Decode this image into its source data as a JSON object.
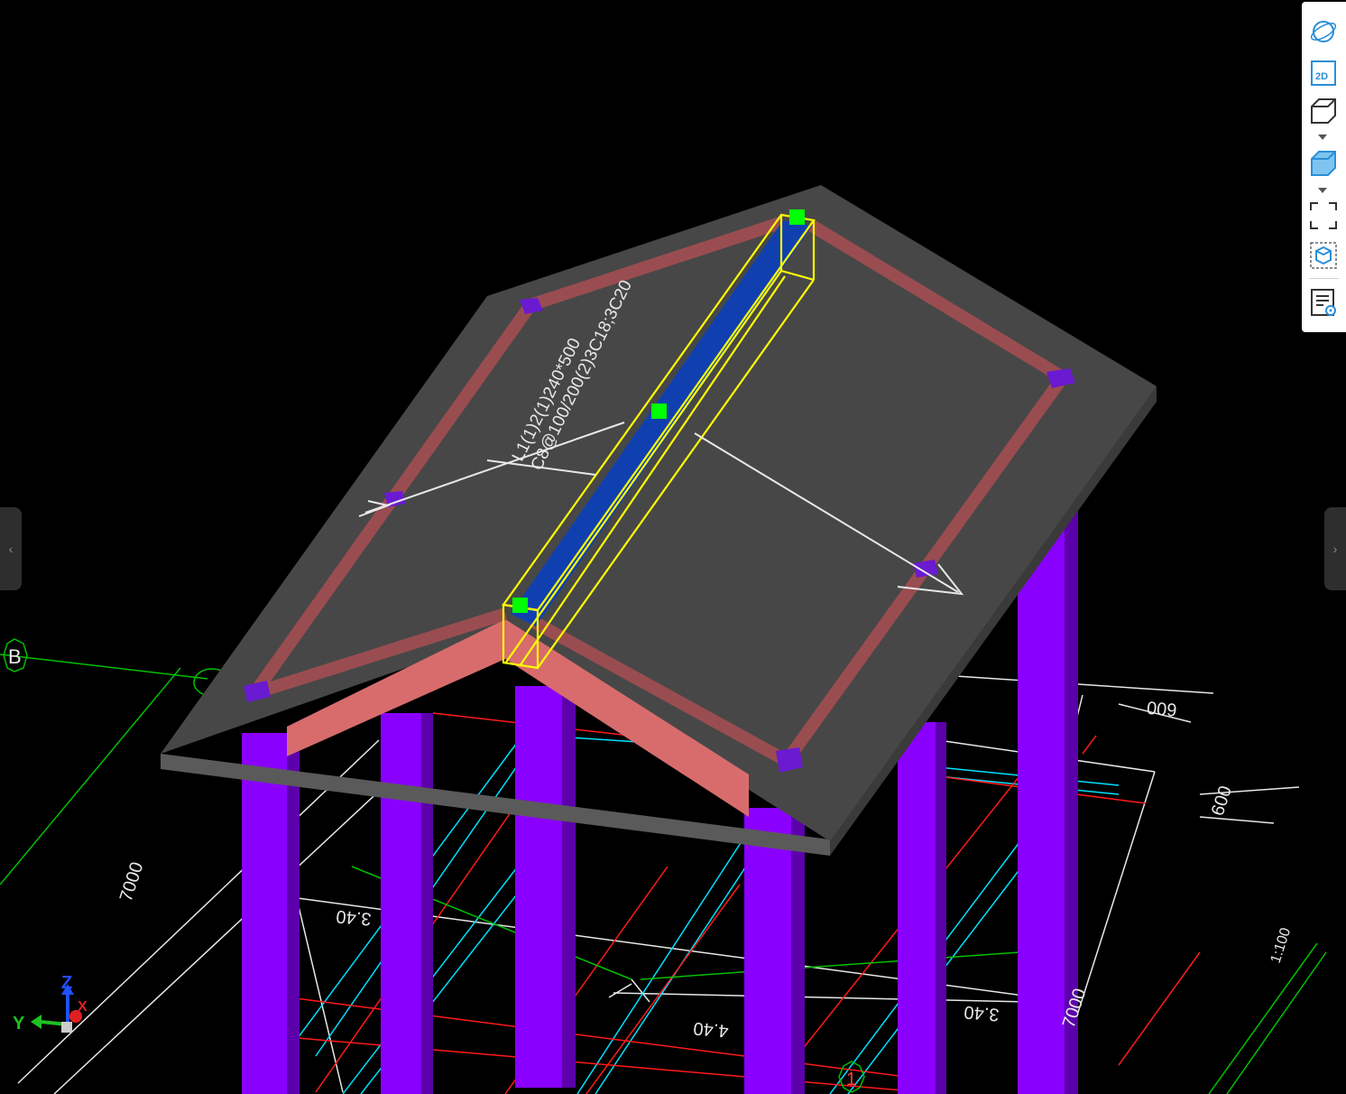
{
  "viewport": {
    "beam_annotation": {
      "line1": "L1(1)2(1)240*500",
      "line2": "C8@100/200(2)3C18;3C20"
    },
    "grid_labels": {
      "axis_b": "B",
      "axis_1": "1"
    },
    "dimensions": {
      "d7000_left": "7000",
      "d7000_right": "7000",
      "d600_upper": "600",
      "d600_right": "600",
      "d340_left": "3.40",
      "d340_right": "3.40",
      "d440": "4.40",
      "scale": "1:100"
    },
    "axis_gizmo": {
      "x": "X",
      "y": "Y",
      "z": "Z"
    }
  },
  "toolbar": {
    "buttons": [
      {
        "icon": "orbit-icon"
      },
      {
        "icon": "view-2d-icon",
        "label": "2D"
      },
      {
        "icon": "wireframe-cube-icon"
      },
      {
        "icon": "shaded-cube-icon"
      },
      {
        "icon": "fit-view-icon"
      },
      {
        "icon": "selection-box-icon"
      },
      {
        "icon": "property-view-icon"
      }
    ]
  },
  "side_tabs": {
    "left": "‹",
    "right": "›"
  },
  "colors": {
    "background": "#000000",
    "roof_slab": "#474747",
    "roof_edge": "#5a5a5a",
    "edge_beam": "#9a4d50",
    "gable_beam": "#d86c6c",
    "column": "#8a00ff",
    "column_shade": "#5b00aa",
    "selected_beam": "#1040b0",
    "selection_outline": "#ffff00",
    "grip": "#00ff00",
    "cad_white": "#e8e8e8",
    "cad_cyan": "#00e0ff",
    "cad_red": "#ff1a1a",
    "cad_green": "#00c000",
    "toolbar_accent": "#2a8fd8"
  }
}
